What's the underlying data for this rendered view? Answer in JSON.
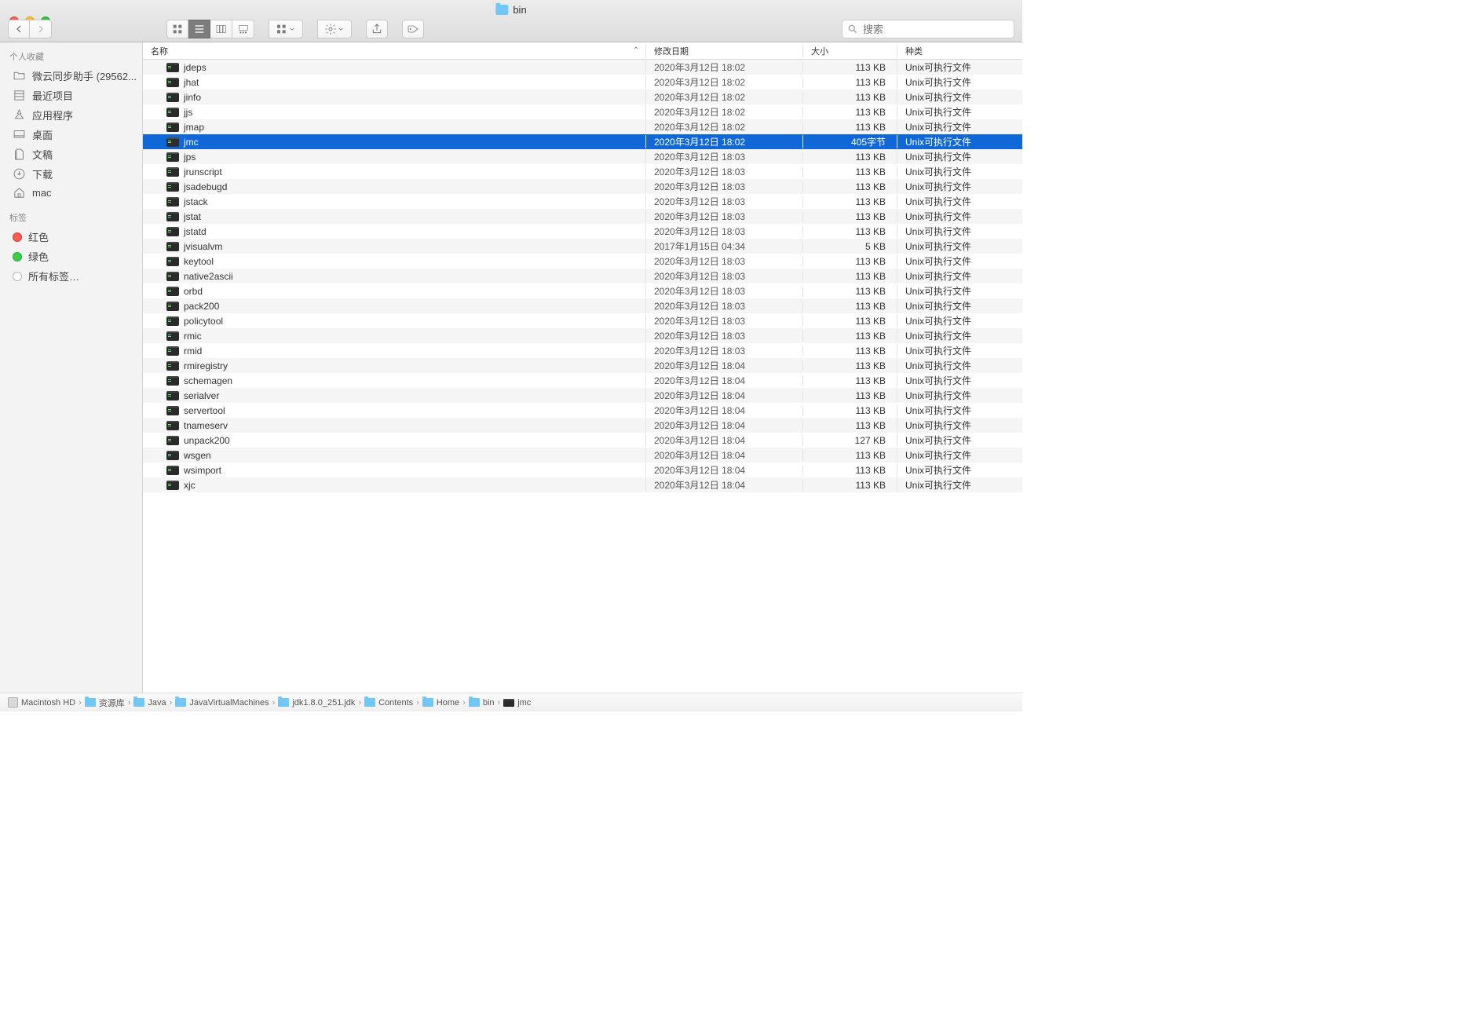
{
  "window": {
    "title": "bin"
  },
  "search": {
    "placeholder": "搜索"
  },
  "sidebar": {
    "section_favorites": "个人收藏",
    "section_tags": "标签",
    "items": [
      {
        "label": "微云同步助手 (29562..."
      },
      {
        "label": "最近项目"
      },
      {
        "label": "应用程序"
      },
      {
        "label": "桌面"
      },
      {
        "label": "文稿"
      },
      {
        "label": "下载"
      },
      {
        "label": "mac"
      }
    ],
    "tags": [
      {
        "label": "红色",
        "color": "red"
      },
      {
        "label": "绿色",
        "color": "green"
      },
      {
        "label": "所有标签…",
        "color": "grey"
      }
    ]
  },
  "columns": {
    "name": "名称",
    "date": "修改日期",
    "size": "大小",
    "kind": "种类"
  },
  "kind_exec": "Unix可执行文件",
  "files": [
    {
      "name": "jdeps",
      "date": "2020年3月12日 18:02",
      "size": "113 KB",
      "selected": false
    },
    {
      "name": "jhat",
      "date": "2020年3月12日 18:02",
      "size": "113 KB",
      "selected": false
    },
    {
      "name": "jinfo",
      "date": "2020年3月12日 18:02",
      "size": "113 KB",
      "selected": false
    },
    {
      "name": "jjs",
      "date": "2020年3月12日 18:02",
      "size": "113 KB",
      "selected": false
    },
    {
      "name": "jmap",
      "date": "2020年3月12日 18:02",
      "size": "113 KB",
      "selected": false
    },
    {
      "name": "jmc",
      "date": "2020年3月12日 18:02",
      "size": "405字节",
      "selected": true
    },
    {
      "name": "jps",
      "date": "2020年3月12日 18:03",
      "size": "113 KB",
      "selected": false
    },
    {
      "name": "jrunscript",
      "date": "2020年3月12日 18:03",
      "size": "113 KB",
      "selected": false
    },
    {
      "name": "jsadebugd",
      "date": "2020年3月12日 18:03",
      "size": "113 KB",
      "selected": false
    },
    {
      "name": "jstack",
      "date": "2020年3月12日 18:03",
      "size": "113 KB",
      "selected": false
    },
    {
      "name": "jstat",
      "date": "2020年3月12日 18:03",
      "size": "113 KB",
      "selected": false
    },
    {
      "name": "jstatd",
      "date": "2020年3月12日 18:03",
      "size": "113 KB",
      "selected": false
    },
    {
      "name": "jvisualvm",
      "date": "2017年1月15日 04:34",
      "size": "5 KB",
      "selected": false
    },
    {
      "name": "keytool",
      "date": "2020年3月12日 18:03",
      "size": "113 KB",
      "selected": false
    },
    {
      "name": "native2ascii",
      "date": "2020年3月12日 18:03",
      "size": "113 KB",
      "selected": false
    },
    {
      "name": "orbd",
      "date": "2020年3月12日 18:03",
      "size": "113 KB",
      "selected": false
    },
    {
      "name": "pack200",
      "date": "2020年3月12日 18:03",
      "size": "113 KB",
      "selected": false
    },
    {
      "name": "policytool",
      "date": "2020年3月12日 18:03",
      "size": "113 KB",
      "selected": false
    },
    {
      "name": "rmic",
      "date": "2020年3月12日 18:03",
      "size": "113 KB",
      "selected": false
    },
    {
      "name": "rmid",
      "date": "2020年3月12日 18:03",
      "size": "113 KB",
      "selected": false
    },
    {
      "name": "rmiregistry",
      "date": "2020年3月12日 18:04",
      "size": "113 KB",
      "selected": false
    },
    {
      "name": "schemagen",
      "date": "2020年3月12日 18:04",
      "size": "113 KB",
      "selected": false
    },
    {
      "name": "serialver",
      "date": "2020年3月12日 18:04",
      "size": "113 KB",
      "selected": false
    },
    {
      "name": "servertool",
      "date": "2020年3月12日 18:04",
      "size": "113 KB",
      "selected": false
    },
    {
      "name": "tnameserv",
      "date": "2020年3月12日 18:04",
      "size": "113 KB",
      "selected": false
    },
    {
      "name": "unpack200",
      "date": "2020年3月12日 18:04",
      "size": "127 KB",
      "selected": false
    },
    {
      "name": "wsgen",
      "date": "2020年3月12日 18:04",
      "size": "113 KB",
      "selected": false
    },
    {
      "name": "wsimport",
      "date": "2020年3月12日 18:04",
      "size": "113 KB",
      "selected": false
    },
    {
      "name": "xjc",
      "date": "2020年3月12日 18:04",
      "size": "113 KB",
      "selected": false
    }
  ],
  "path": [
    {
      "label": "Macintosh HD",
      "icon": "disk"
    },
    {
      "label": "资源库",
      "icon": "folder"
    },
    {
      "label": "Java",
      "icon": "folder"
    },
    {
      "label": "JavaVirtualMachines",
      "icon": "folder"
    },
    {
      "label": "jdk1.8.0_251.jdk",
      "icon": "folder"
    },
    {
      "label": "Contents",
      "icon": "folder"
    },
    {
      "label": "Home",
      "icon": "folder"
    },
    {
      "label": "bin",
      "icon": "folder"
    },
    {
      "label": "jmc",
      "icon": "exec"
    }
  ]
}
